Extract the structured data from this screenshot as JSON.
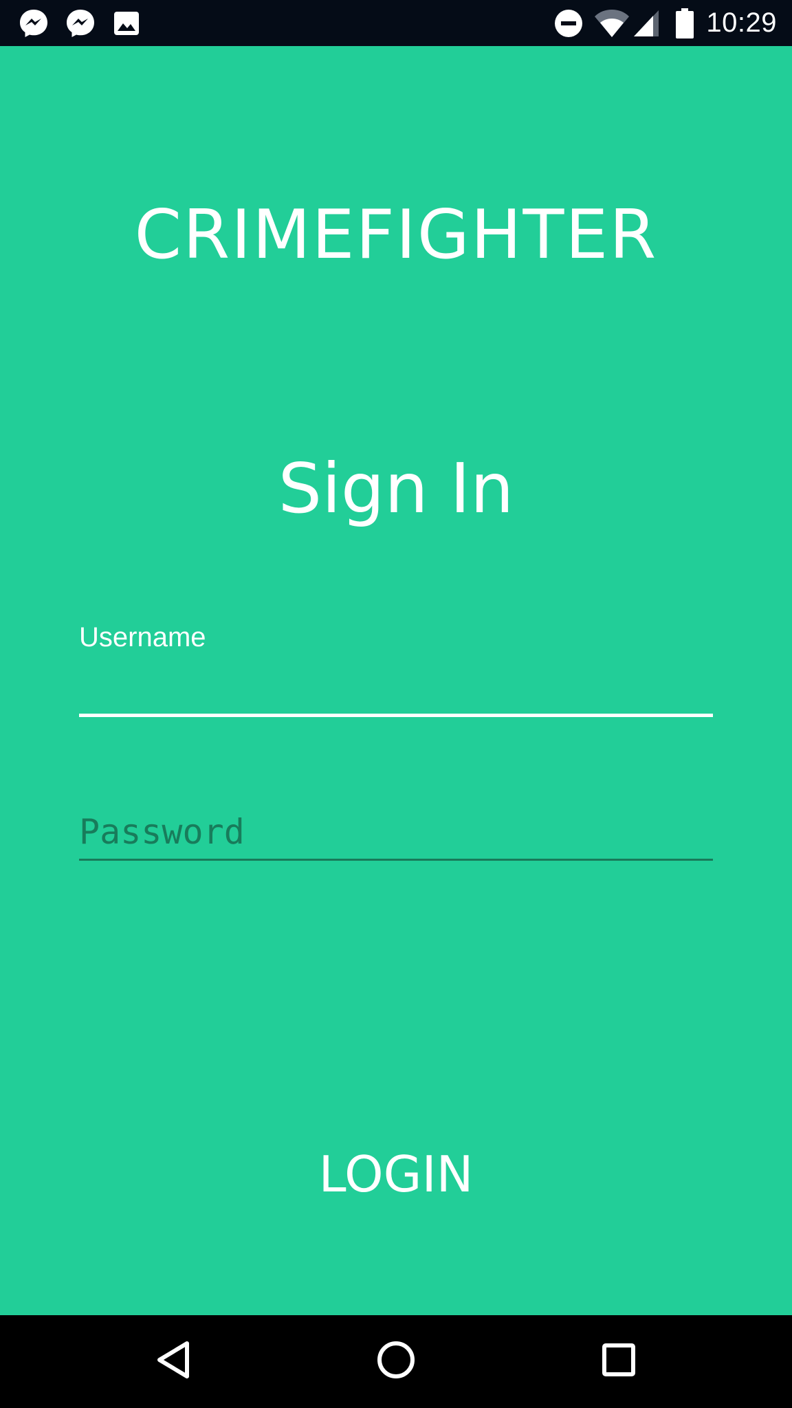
{
  "status_bar": {
    "time": "10:29",
    "left_icons": [
      "messenger-icon",
      "messenger-icon",
      "image-icon"
    ],
    "right_icons": [
      "do-not-disturb-icon",
      "wifi-icon",
      "cell-signal-icon",
      "battery-icon"
    ]
  },
  "app": {
    "title": "CRIMEFIGHTER",
    "heading": "Sign In",
    "username_label": "Username",
    "username_value": "",
    "password_placeholder": "Password",
    "password_value": "",
    "login_label": "LOGIN"
  },
  "nav_bar": {
    "buttons": [
      "back-icon",
      "home-icon",
      "recents-icon"
    ]
  },
  "colors": {
    "background": "#22ce98",
    "status_bar": "#050c17",
    "nav_bar": "#000000",
    "text": "#ffffff",
    "placeholder": "#187c5b",
    "inactive_underline": "#197a5a"
  }
}
